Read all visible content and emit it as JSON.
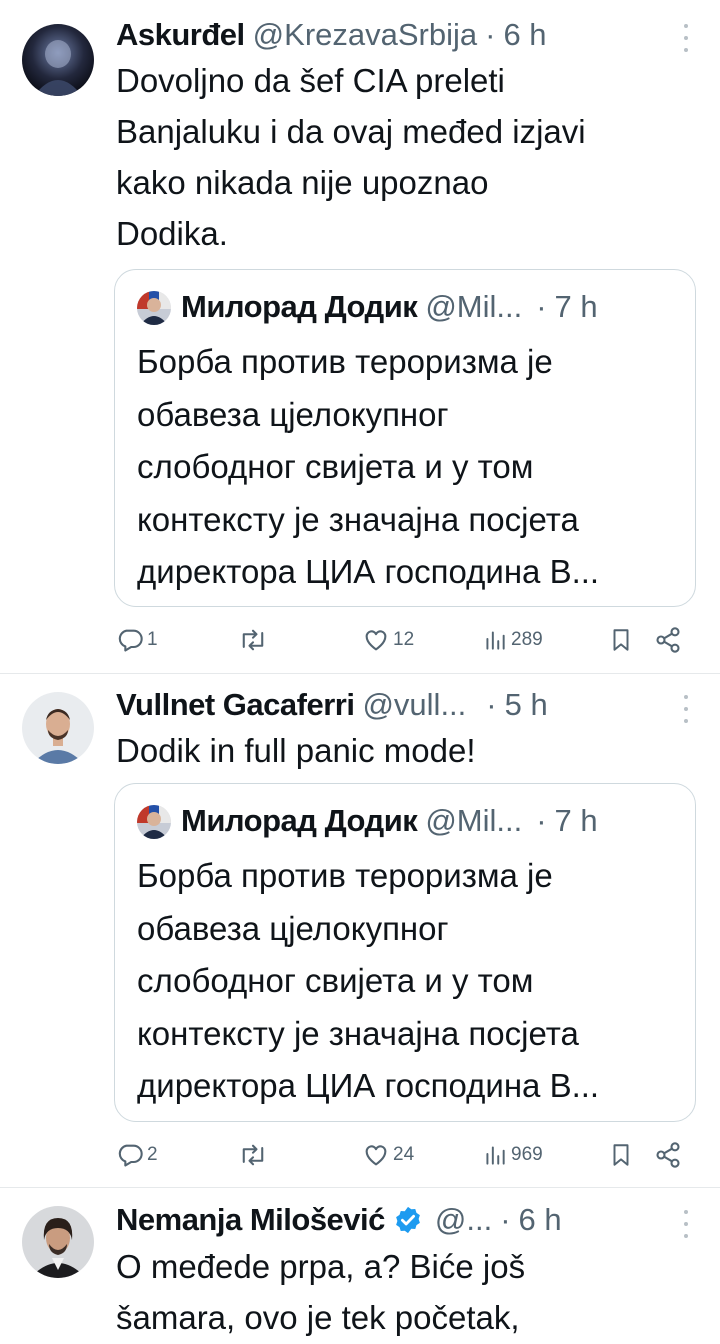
{
  "colors": {
    "text": "#0f1419",
    "muted": "#536471",
    "border": "#cfd9de",
    "verified": "#1d9bf0"
  },
  "tweets": [
    {
      "name": "Askurđel",
      "handle": "@KrezavaSrbija",
      "dot": "·",
      "time": "6 h",
      "text_lines": [
        "Dovoljno da šef CIA preleti",
        "Banjaluku i da ovaj međed izjavi",
        "kako nikada nije upoznao",
        "Dodika."
      ],
      "quote": {
        "name": "Милорад Додик",
        "handle": "@Mil...",
        "dot": "·",
        "time": "7 h",
        "text_lines": [
          "Борба против тероризма је",
          "обавеза цјелокупног",
          "слободног свијета и у том",
          "контексту је значајна посјета",
          "директора ЦИА господина В..."
        ]
      },
      "actions": {
        "replies": "1",
        "reposts": "",
        "likes": "12",
        "views": "289"
      }
    },
    {
      "name": "Vullnet Gacaferri",
      "handle": "@vull...",
      "dot": "·",
      "time": "5 h",
      "text_lines": [
        "Dodik in full panic mode!"
      ],
      "quote": {
        "name": "Милорад Додик",
        "handle": "@Mil...",
        "dot": "·",
        "time": "7 h",
        "text_lines": [
          "Борба против тероризма је",
          "обавеза цјелокупног",
          "слободног свијета и у том",
          "контексту је значајна посјета",
          "директора ЦИА господина В..."
        ]
      },
      "actions": {
        "replies": "2",
        "reposts": "",
        "likes": "24",
        "views": "969"
      }
    },
    {
      "name": "Nemanja Milošević",
      "handle": "@...",
      "dot": "·",
      "time": "6 h",
      "text_lines": [
        "O međede prpa, a? Biće još",
        "šamara, ovo je tek početak,"
      ]
    }
  ]
}
